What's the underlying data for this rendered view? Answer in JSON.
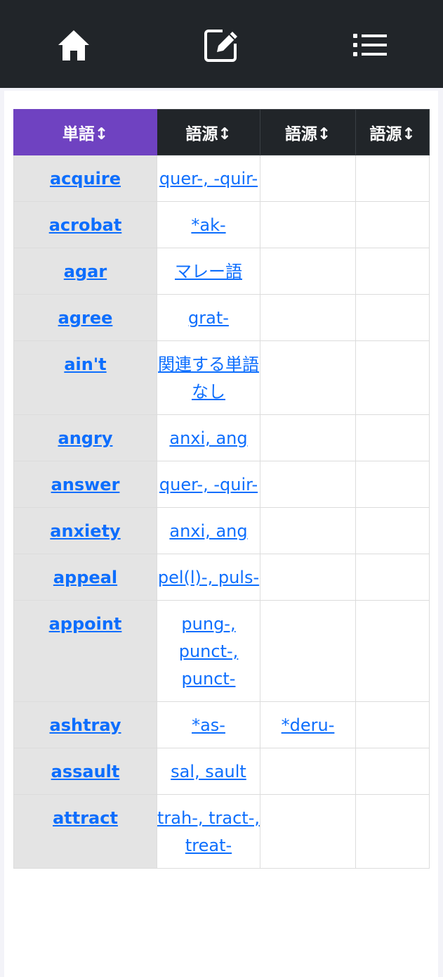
{
  "nav": {
    "home_icon": "home-icon",
    "edit_icon": "edit-icon",
    "menu_icon": "list-icon"
  },
  "table": {
    "headers": [
      "単語↕",
      "語源↕",
      "語源↕",
      "語源↕"
    ],
    "rows": [
      {
        "word": "acquire",
        "roots": [
          "quer-, -quir-",
          "",
          ""
        ]
      },
      {
        "word": "acrobat",
        "roots": [
          "*ak-",
          "",
          ""
        ]
      },
      {
        "word": "agar",
        "roots": [
          "マレー語",
          "",
          ""
        ]
      },
      {
        "word": "agree",
        "roots": [
          "grat-",
          "",
          ""
        ]
      },
      {
        "word": "ain't",
        "roots": [
          "関連する単語なし",
          "",
          ""
        ]
      },
      {
        "word": "angry",
        "roots": [
          "anxi, ang",
          "",
          ""
        ]
      },
      {
        "word": "answer",
        "roots": [
          "quer-, -quir-",
          "",
          ""
        ]
      },
      {
        "word": "anxiety",
        "roots": [
          "anxi, ang",
          "",
          ""
        ]
      },
      {
        "word": "appeal",
        "roots": [
          "pel(l)-, puls-",
          "",
          ""
        ]
      },
      {
        "word": "appoint",
        "roots": [
          "pung-, punct-, punct-",
          "",
          ""
        ]
      },
      {
        "word": "ashtray",
        "roots": [
          "*as-",
          "*deru-",
          ""
        ]
      },
      {
        "word": "assault",
        "roots": [
          "sal, sault",
          "",
          ""
        ]
      },
      {
        "word": "attract",
        "roots": [
          "trah-, tract-, treat-",
          "",
          ""
        ]
      }
    ]
  },
  "colors": {
    "topbar": "#212529",
    "word_header": "#6f42c1",
    "link": "#0d6efd"
  }
}
